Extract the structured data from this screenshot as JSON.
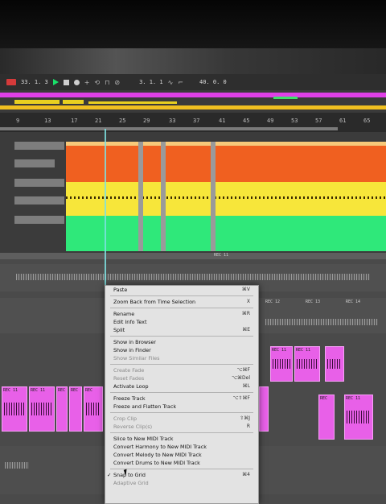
{
  "transport": {
    "position": "33. 1. 3",
    "loop_start": "3. 1. 1",
    "loop_length": "40. 0. 0"
  },
  "ruler": {
    "ticks": [
      "9",
      "13",
      "17",
      "21",
      "25",
      "29",
      "33",
      "37",
      "41",
      "45",
      "49",
      "53",
      "57",
      "61",
      "65"
    ]
  },
  "clip_labels": {
    "rec11": "REC 11",
    "rec_mid": "REC 12",
    "rec_right_a": "REC 13",
    "rec_right_b": "REC 14",
    "rec_right_c": "REC 11",
    "rec_right_d": "REC 11",
    "rec_left_a": "REC 11",
    "rec_left_b": "REC 11",
    "rec_left_c": "REC",
    "rec_left_d": "REC",
    "rec_left_e": "REC",
    "rec_bottom_a": "REC",
    "rec_bottom_b": "REC 11"
  },
  "menu": {
    "items": [
      {
        "label": "Paste",
        "shortcut": "⌘V",
        "enabled": true
      },
      {
        "sep": true
      },
      {
        "label": "Zoom Back from Time Selection",
        "shortcut": "X",
        "enabled": true
      },
      {
        "sep": true
      },
      {
        "label": "Rename",
        "shortcut": "⌘R",
        "enabled": true
      },
      {
        "label": "Edit Info Text",
        "shortcut": "",
        "enabled": true
      },
      {
        "label": "Split",
        "shortcut": "⌘E",
        "enabled": true
      },
      {
        "sep": true
      },
      {
        "label": "Show in Browser",
        "shortcut": "",
        "enabled": true
      },
      {
        "label": "Show in Finder",
        "shortcut": "",
        "enabled": true
      },
      {
        "label": "Show Similar Files",
        "shortcut": "",
        "enabled": false
      },
      {
        "sep": true
      },
      {
        "label": "Create Fade",
        "shortcut": "⌥⌘F",
        "enabled": false
      },
      {
        "label": "Reset Fades",
        "shortcut": "⌥⌘Del",
        "enabled": false
      },
      {
        "label": "Activate Loop",
        "shortcut": "⌘L",
        "enabled": true
      },
      {
        "sep": true
      },
      {
        "label": "Freeze Track",
        "shortcut": "⌥⇧⌘F",
        "enabled": true
      },
      {
        "label": "Freeze and Flatten Track",
        "shortcut": "",
        "enabled": true
      },
      {
        "sep": true
      },
      {
        "label": "Crop Clip",
        "shortcut": "⇧⌘J",
        "enabled": false
      },
      {
        "label": "Reverse Clip(s)",
        "shortcut": "R",
        "enabled": false
      },
      {
        "sep": true
      },
      {
        "label": "Slice to New MIDI Track",
        "shortcut": "",
        "enabled": true
      },
      {
        "label": "Convert Harmony to New MIDI Track",
        "shortcut": "",
        "enabled": true
      },
      {
        "label": "Convert Melody to New MIDI Track",
        "shortcut": "",
        "enabled": true
      },
      {
        "label": "Convert Drums to New MIDI Track",
        "shortcut": "",
        "enabled": true
      },
      {
        "sep": true
      },
      {
        "label": "Snap to Grid",
        "shortcut": "⌘4",
        "enabled": true,
        "checked": true
      },
      {
        "label": "Adaptive Grid",
        "shortcut": "",
        "enabled": false
      }
    ]
  },
  "colors": {
    "accent_red": "#f06020",
    "accent_yellow": "#f7e63a",
    "accent_green": "#2fe87a",
    "accent_pink": "#e860e8"
  }
}
